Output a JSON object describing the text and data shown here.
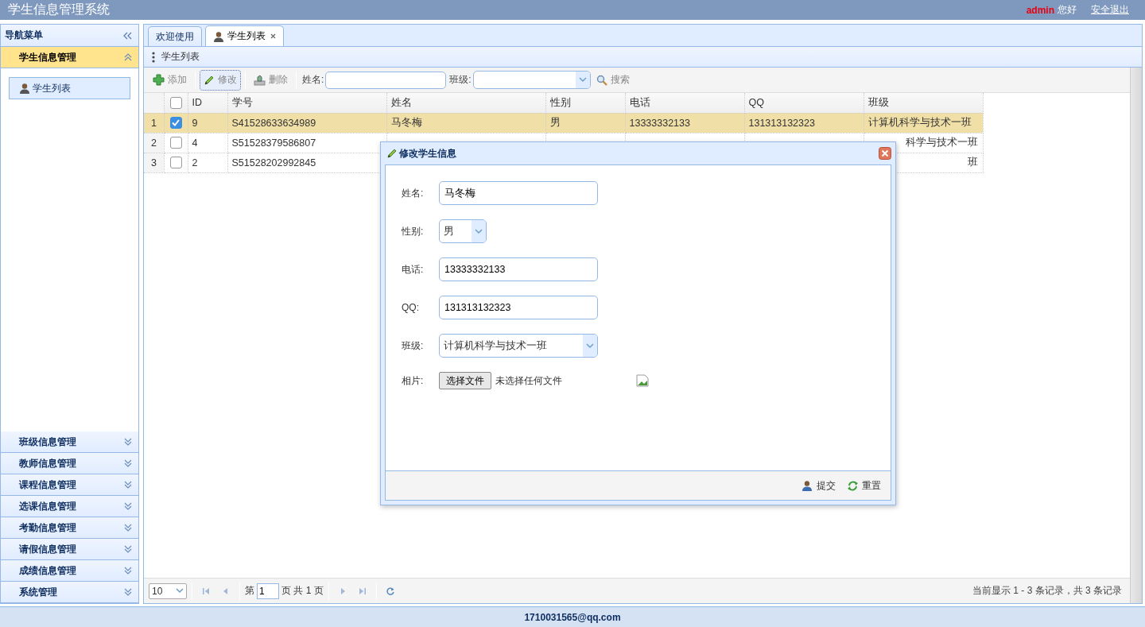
{
  "header": {
    "title": "学生信息管理系统",
    "user": "admin",
    "greeting": "您好",
    "logout": "安全退出"
  },
  "sidebar": {
    "title": "导航菜单",
    "sections": [
      {
        "label": "学生信息管理",
        "expanded": true,
        "children": [
          {
            "label": "学生列表",
            "selected": true
          }
        ]
      },
      {
        "label": "班级信息管理",
        "expanded": false
      },
      {
        "label": "教师信息管理",
        "expanded": false
      },
      {
        "label": "课程信息管理",
        "expanded": false
      },
      {
        "label": "选课信息管理",
        "expanded": false
      },
      {
        "label": "考勤信息管理",
        "expanded": false
      },
      {
        "label": "请假信息管理",
        "expanded": false
      },
      {
        "label": "成绩信息管理",
        "expanded": false
      },
      {
        "label": "系统管理",
        "expanded": false
      }
    ]
  },
  "tabs": [
    {
      "label": "欢迎使用",
      "selected": false,
      "closable": false
    },
    {
      "label": "学生列表",
      "selected": true,
      "closable": true
    }
  ],
  "panel": {
    "title": "学生列表",
    "toolbar": {
      "buttons": [
        {
          "label": "添加",
          "kind": "add",
          "focused": false
        },
        {
          "label": "修改",
          "kind": "edit",
          "focused": true
        },
        {
          "label": "删除",
          "kind": "delete",
          "focused": false
        }
      ],
      "name_label": "姓名:",
      "class_label": "班级:",
      "search": "搜索"
    },
    "grid": {
      "all_checked": false,
      "columns": [
        "ID",
        "学号",
        "姓名",
        "性别",
        "电话",
        "QQ",
        "班级"
      ],
      "rows": [
        {
          "number": "1",
          "checked": true,
          "cells": [
            "9",
            "S41528633634989",
            "马冬梅",
            "男",
            "13333332133",
            "131313132323",
            "计算机科学与技术一班"
          ]
        },
        {
          "number": "2",
          "checked": false,
          "cells": [
            "4",
            "S51528379586807",
            null,
            null,
            null,
            null,
            "科学与技术一班"
          ]
        },
        {
          "number": "3",
          "checked": false,
          "cells": [
            "2",
            "S51528202992845",
            null,
            null,
            null,
            null,
            "班"
          ]
        }
      ]
    },
    "pager": {
      "page_size": "10",
      "page_prefix": "第",
      "page": "1",
      "page_suffix": "页 共 1 页",
      "info": "当前显示 1 - 3 条记录，共 3 条记录"
    }
  },
  "dialog": {
    "title": "修改学生信息",
    "fields": [
      {
        "kind": "text",
        "label": "姓名:",
        "value": "马冬梅"
      },
      {
        "kind": "select",
        "label": "性别:",
        "value": "男"
      },
      {
        "kind": "text",
        "label": "电话:",
        "value": "13333332133"
      },
      {
        "kind": "text",
        "label": "QQ:",
        "value": "131313132323"
      },
      {
        "kind": "select",
        "label": "班级:",
        "value": "计算机科学与技术一班"
      },
      {
        "kind": "file",
        "label": "相片:",
        "button": "选择文件",
        "status": "未选择任何文件"
      }
    ],
    "buttons": [
      {
        "label": "提交",
        "kind": "submit"
      },
      {
        "label": "重置",
        "kind": "reset"
      }
    ]
  },
  "footer": "1710031565@qq.com"
}
